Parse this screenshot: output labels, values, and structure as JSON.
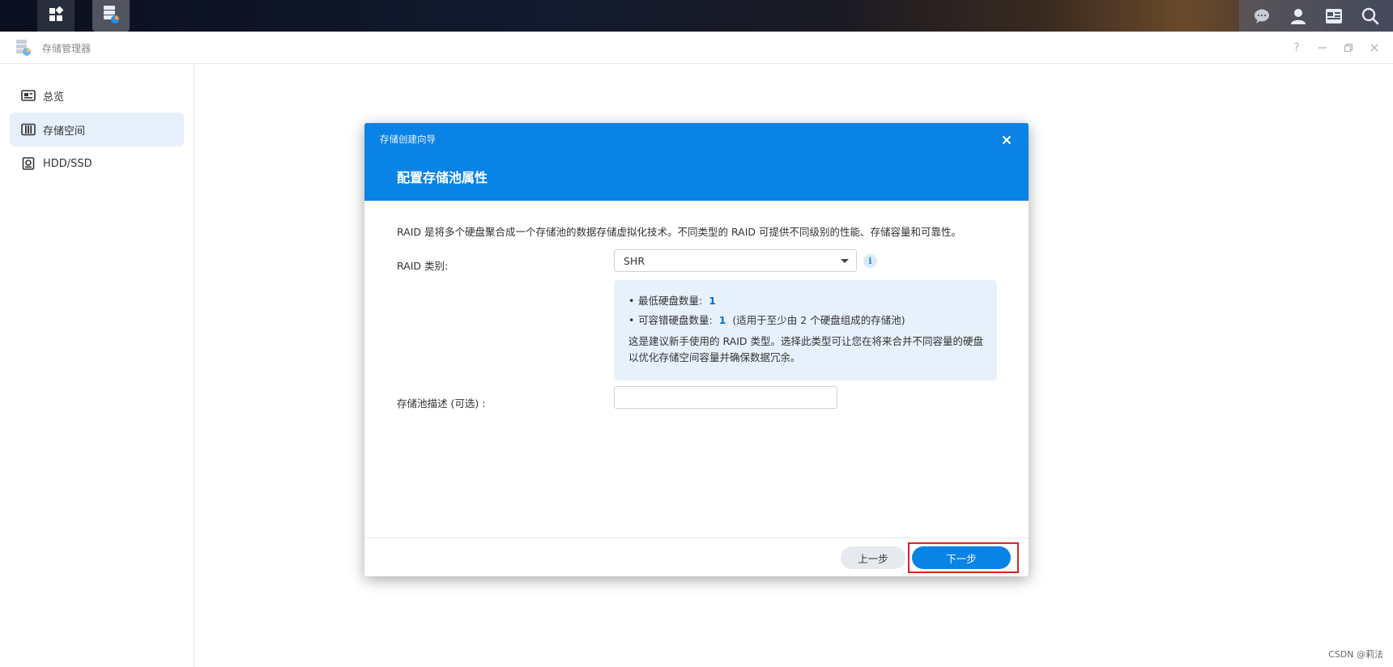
{
  "window": {
    "title": "存储管理器"
  },
  "sidebar": {
    "items": [
      {
        "label": "总览",
        "icon": "overview-icon"
      },
      {
        "label": "存储空间",
        "icon": "storage-icon"
      },
      {
        "label": "HDD/SSD",
        "icon": "disk-icon"
      }
    ],
    "active": 1
  },
  "dialog": {
    "wizard_title": "存储创建向导",
    "step_title": "配置存储池属性",
    "description": "RAID 是将多个硬盘聚合成一个存储池的数据存储虚拟化技术。不同类型的 RAID 可提供不同级别的性能、存储容量和可靠性。",
    "raid_label": "RAID 类别:",
    "raid_value": "SHR",
    "info_glyph": "i",
    "info": {
      "min_disks_label": "最低硬盘数量:",
      "min_disks_value": "1",
      "fault_tol_label": "可容错硬盘数量:",
      "fault_tol_value": "1",
      "fault_tol_note": "(适用于至少由 2 个硬盘组成的存储池)",
      "note": "这是建议新手使用的 RAID 类型。选择此类型可让您在将来合并不同容量的硬盘以优化存储空间容量并确保数据冗余。"
    },
    "pool_desc_label": "存储池描述 (可选) :",
    "pool_desc_value": "",
    "prev_label": "上一步",
    "next_label": "下一步"
  },
  "watermark": "CSDN @莉法",
  "colors": {
    "accent": "#0a83e6",
    "highlight": "#e02020",
    "sidebar_active": "#e5f0fb",
    "infobox": "#e6f1fc"
  }
}
